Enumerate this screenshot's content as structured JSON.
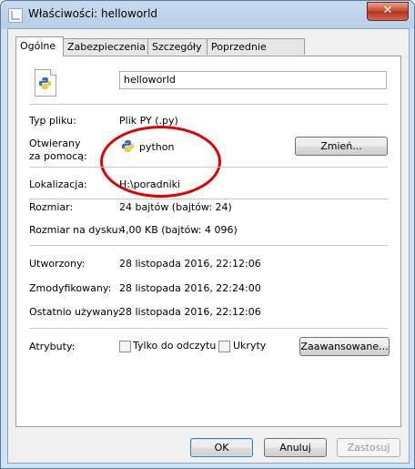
{
  "window": {
    "title": "Właściwości: helloworld",
    "close": "✕"
  },
  "tabs": [
    {
      "label": "Ogólne"
    },
    {
      "label": "Zabezpieczenia"
    },
    {
      "label": "Szczegóły"
    },
    {
      "label": "Poprzednie wersje"
    }
  ],
  "general": {
    "file_name": "helloworld",
    "type_label": "Typ pliku:",
    "type_value": "Plik PY (.py)",
    "opens_label_1": "Otwierany",
    "opens_label_2": "za pomocą:",
    "opens_value": "python",
    "change_button": "Zmień...",
    "location_label": "Lokalizacja:",
    "location_value": "H:\\poradniki",
    "size_label": "Rozmiar:",
    "size_value": "24 bajtów (bajtów: 24)",
    "size_on_disk_label": "Rozmiar na dysku:",
    "size_on_disk_value": "4,00 KB (bajtów: 4 096)",
    "created_label": "Utworzony:",
    "created_value": "28 listopada 2016, 22:12:06",
    "modified_label": "Zmodyfikowany:",
    "modified_value": "28 listopada 2016, 22:24:00",
    "accessed_label": "Ostatnio używany:",
    "accessed_value": "28 listopada 2016, 22:12:06",
    "attributes_label": "Atrybuty:",
    "readonly_label": "Tylko do odczytu",
    "hidden_label": "Ukryty",
    "advanced_button": "Zaawansowane..."
  },
  "footer": {
    "ok": "OK",
    "cancel": "Anuluj",
    "apply": "Zastosuj"
  },
  "colors": {
    "annotation": "#e00000",
    "python_blue": "#3b73a8",
    "python_yellow": "#f2c83a"
  }
}
